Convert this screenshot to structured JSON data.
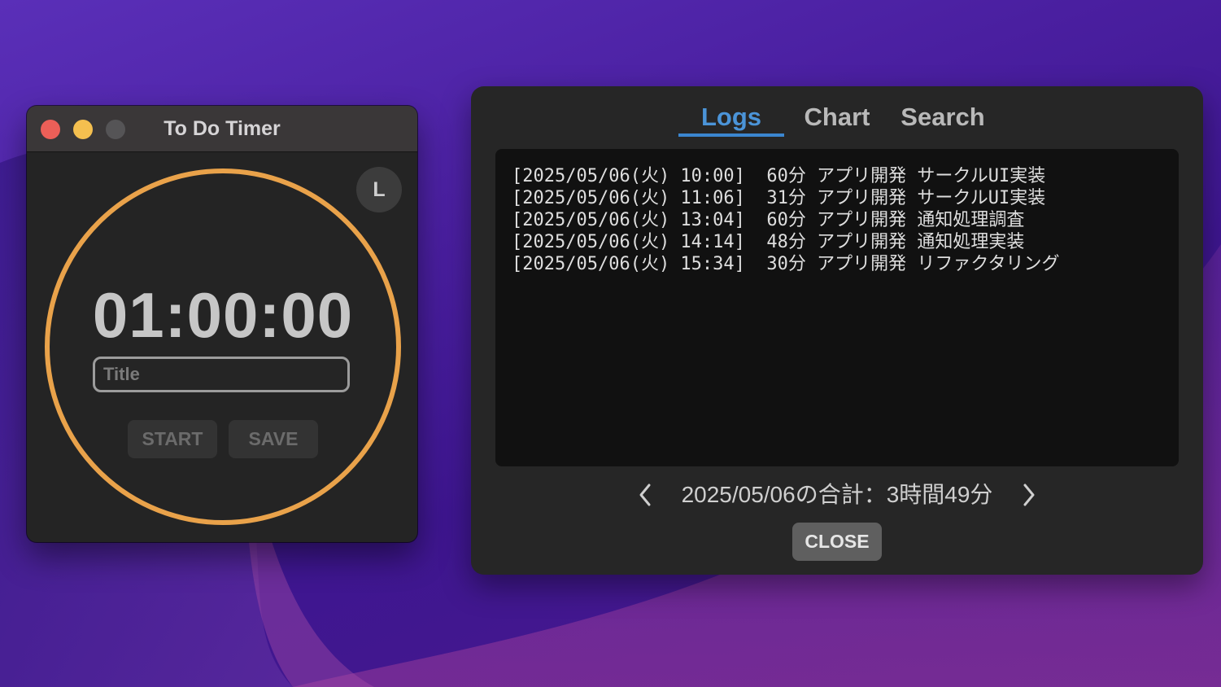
{
  "timer_window": {
    "title": "To Do Timer",
    "badge": "L",
    "time": "01:00:00",
    "title_placeholder": "Title",
    "title_value": "",
    "start_label": "START",
    "save_label": "SAVE",
    "ring_color": "#e9a24a"
  },
  "logs_panel": {
    "tabs": [
      {
        "label": "Logs",
        "active": true
      },
      {
        "label": "Chart",
        "active": false
      },
      {
        "label": "Search",
        "active": false
      }
    ],
    "entries": [
      "[2025/05/06(火) 10:00]  60分 アプリ開発 サークルUI実装",
      "[2025/05/06(火) 11:06]  31分 アプリ開発 サークルUI実装",
      "[2025/05/06(火) 13:04]  60分 アプリ開発 通知処理調査",
      "[2025/05/06(火) 14:14]  48分 アプリ開発 通知処理実装",
      "[2025/05/06(火) 15:34]  30分 アプリ開発 リファクタリング"
    ],
    "total_text": "2025/05/06の合計：3時間49分",
    "close_label": "CLOSE",
    "accent_color": "#3b86d0"
  }
}
